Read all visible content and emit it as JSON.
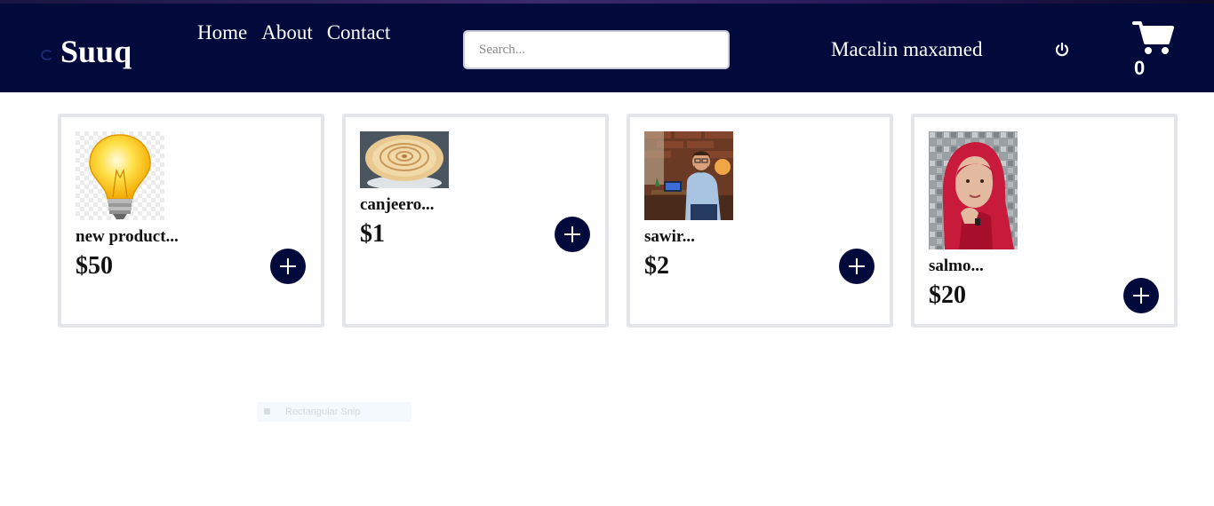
{
  "brand": {
    "name": "Suuq"
  },
  "nav": {
    "links": [
      "Home",
      "About",
      "Contact"
    ]
  },
  "search": {
    "placeholder": "Search..."
  },
  "user": {
    "name": "Macalin maxamed"
  },
  "cart": {
    "count": "0"
  },
  "colors": {
    "navbar": "#020a3c",
    "card_border": "#e4e5ea",
    "button": "#020a3c"
  },
  "products": [
    {
      "name": "new product...",
      "price": "$50",
      "image": "light-bulb"
    },
    {
      "name": "canjeero...",
      "price": "$1",
      "image": "canjeero-flatbread"
    },
    {
      "name": "sawir...",
      "price": "$2",
      "image": "man-with-laptop"
    },
    {
      "name": "salmo...",
      "price": "$20",
      "image": "woman-in-red-hijab"
    }
  ],
  "overlay": {
    "snip_label": "Rectangular Snip"
  }
}
